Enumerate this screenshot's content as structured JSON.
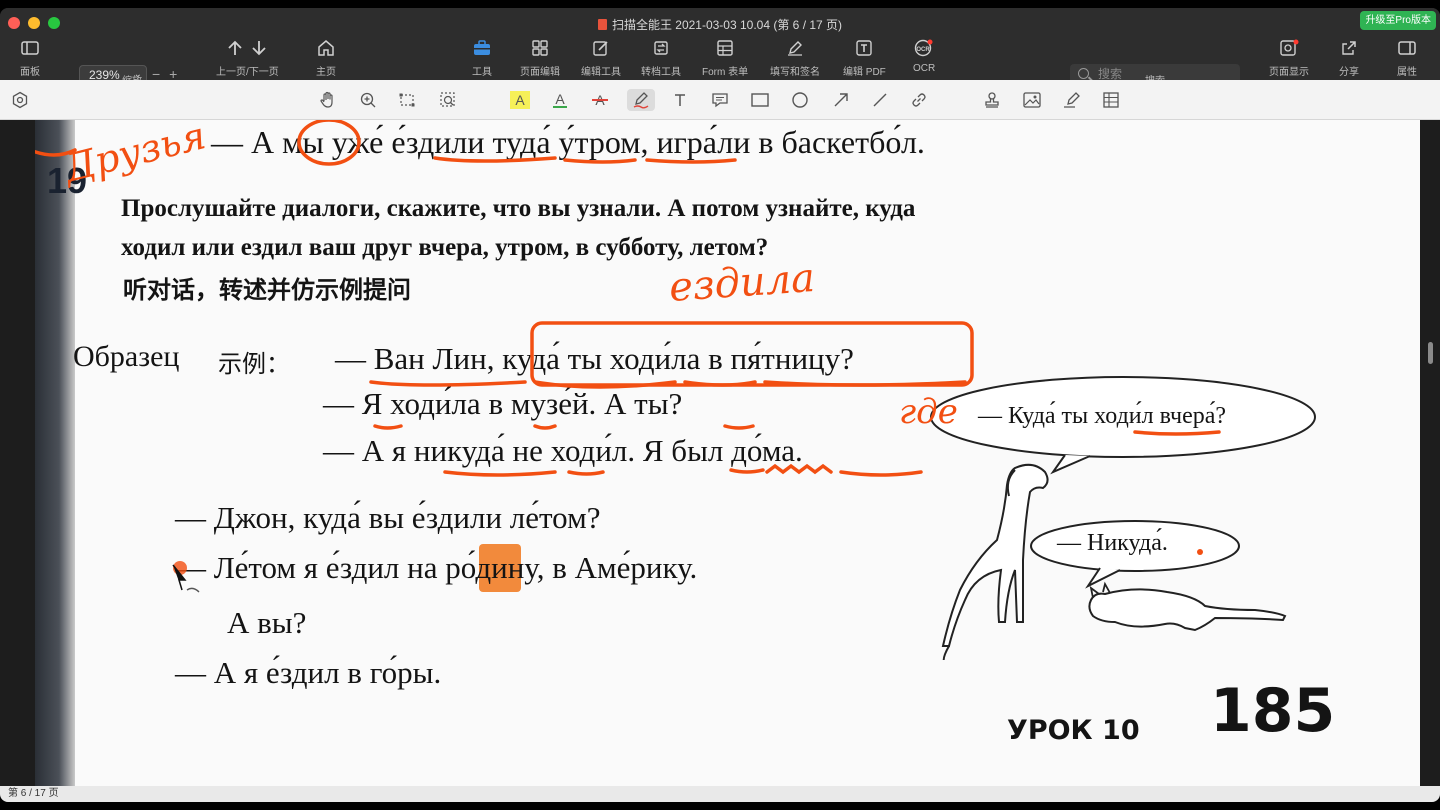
{
  "window": {
    "title": "扫描全能王 2021-03-03 10.04 (第 6 / 17 页)",
    "upgrade_label": "升级至Pro版本"
  },
  "toolbar": {
    "sidebar_label": "面板",
    "zoom_value": "239%",
    "zoom_label": "缩放",
    "prevnext_label": "上一页/下一页",
    "home_label": "主页",
    "tools_label": "工具",
    "page_edit_label": "页面编辑",
    "edit_tools_label": "编辑工具",
    "convert_label": "转档工具",
    "form_label": "Form 表单",
    "fill_sign_label": "填写和签名",
    "edit_pdf_label": "编辑 PDF",
    "ocr_label": "OCR",
    "search_placeholder": "搜索",
    "search_label": "搜索",
    "page_display_label": "页面显示",
    "share_label": "分享",
    "properties_label": "属性"
  },
  "annotation_tools": [
    "hand-tool",
    "zoom-tool",
    "marquee-tool",
    "area-text-tool",
    "highlight-tool",
    "underline-tool",
    "strikethrough-tool",
    "pen-tool",
    "text-tool",
    "note-tool",
    "rectangle-tool",
    "ellipse-tool",
    "arrow-tool",
    "line-tool",
    "link-tool",
    "stamp-tool",
    "image-tool",
    "signature-tool",
    "table-tool"
  ],
  "document": {
    "line1": "— А мы уже́ е́здили туда́ у́тром, игра́ли в баскетбо́л.",
    "exercise_number": "19",
    "instruction1": "Прослушайте диалоги, скажите, что вы узнали. А потом узнайте, куда",
    "instruction2": "ходил или ездил ваш друг вчера, утром, в субботу, летом?",
    "instruction_cn": "听对话，转述并仿示例提问",
    "sample_label": "Образец",
    "sample_label_cn": "示例：",
    "sample_q": "— Ван Лин, куда́ ты ходи́ла в пя́тницу?",
    "sample_a1": "— Я ходи́ла в музе́й. А ты?",
    "sample_a2": "— А я никуда́ не ходи́л. Я был до́ма.",
    "dialog1": "— Джон, куда́ вы е́здили ле́том?",
    "dialog2": "— Ле́том я е́здил на ро́дину, в Аме́рику.",
    "dialog3": "А вы?",
    "dialog4": "— А я е́здил в го́ры.",
    "bubble1": "— Куда́ ты ходи́л вчера́?",
    "bubble2": "— Никуда́.",
    "lesson": "УРОК 10",
    "page_number": "185"
  },
  "handwriting": {
    "note1": "Друзья",
    "note2": "ездила",
    "note3": "где"
  },
  "colors": {
    "annotation": "#f24f12",
    "highlight": "#f28a3c"
  },
  "status": {
    "page_indicator": "第 6 / 17 页"
  }
}
